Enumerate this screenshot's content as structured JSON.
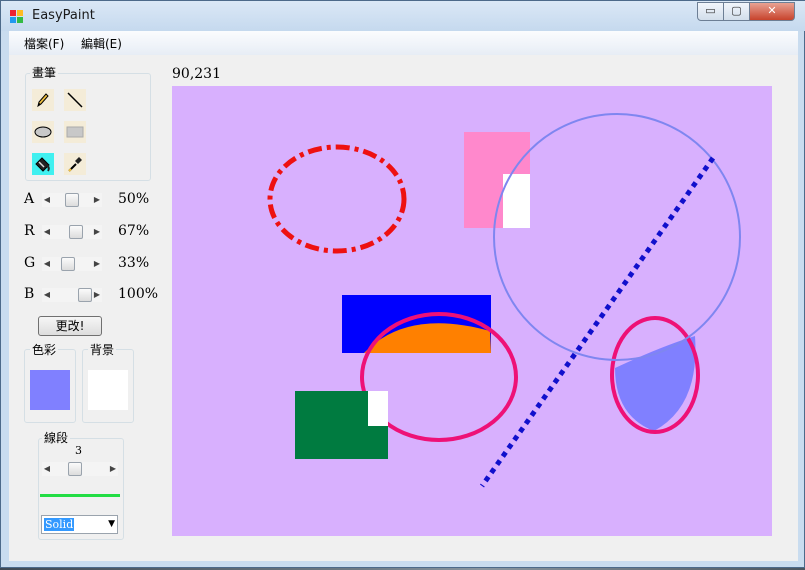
{
  "window": {
    "title": "EasyPaint",
    "controls": {
      "minimize": "▭",
      "maximize": "▢",
      "close": "✕"
    }
  },
  "menu": [
    {
      "label": "檔案(F)"
    },
    {
      "label": "編輯(E)"
    }
  ],
  "coordinates": "90,231",
  "brush": {
    "group_label": "畫筆",
    "tools": [
      {
        "icon": "pencil-icon"
      },
      {
        "icon": "line-icon"
      },
      {
        "icon": "ellipse-icon"
      },
      {
        "icon": "rectangle-icon"
      },
      {
        "icon": "paint-bucket-icon",
        "selected": true
      },
      {
        "icon": "eyedropper-icon"
      }
    ]
  },
  "color_sliders": [
    {
      "label": "A",
      "value": 0.5,
      "text": "50%"
    },
    {
      "label": "R",
      "value": 0.67,
      "text": "67%"
    },
    {
      "label": "G",
      "value": 0.33,
      "text": "33%"
    },
    {
      "label": "B",
      "value": 1.0,
      "text": "100%"
    }
  ],
  "apply_button": "更改!",
  "colors": {
    "foreground_label": "色彩",
    "background_label": "背景",
    "foreground": "#8080ff",
    "background": "#ffffff"
  },
  "line": {
    "group_label": "線段",
    "width_value": "3",
    "width_fraction": 0.3,
    "preview_color": "#22dd44",
    "style_selected": "Solid"
  },
  "canvas": {
    "background": "#d8b0fe",
    "shape_colors": [
      "#ee1111",
      "#ff88cc",
      "#ffffff",
      "#0000ff",
      "#ff8000",
      "#ee1177",
      "#007b40",
      "#8080ff",
      "#7f86f0",
      "#1010cc"
    ]
  }
}
